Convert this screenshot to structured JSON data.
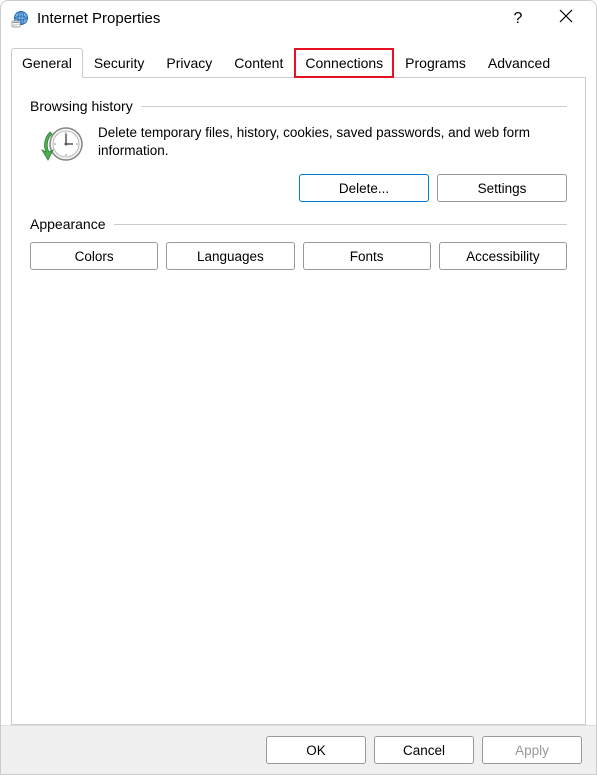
{
  "window": {
    "title": "Internet Properties"
  },
  "tabs": [
    {
      "label": "General",
      "active": true,
      "highlighted": false
    },
    {
      "label": "Security",
      "active": false,
      "highlighted": false
    },
    {
      "label": "Privacy",
      "active": false,
      "highlighted": false
    },
    {
      "label": "Content",
      "active": false,
      "highlighted": false
    },
    {
      "label": "Connections",
      "active": false,
      "highlighted": true
    },
    {
      "label": "Programs",
      "active": false,
      "highlighted": false
    },
    {
      "label": "Advanced",
      "active": false,
      "highlighted": false
    }
  ],
  "browsing_history": {
    "group_title": "Browsing history",
    "description": "Delete temporary files, history, cookies, saved passwords, and web form information.",
    "delete_label": "Delete...",
    "settings_label": "Settings"
  },
  "appearance": {
    "group_title": "Appearance",
    "colors_label": "Colors",
    "languages_label": "Languages",
    "fonts_label": "Fonts",
    "accessibility_label": "Accessibility"
  },
  "footer": {
    "ok_label": "OK",
    "cancel_label": "Cancel",
    "apply_label": "Apply",
    "apply_enabled": false
  }
}
